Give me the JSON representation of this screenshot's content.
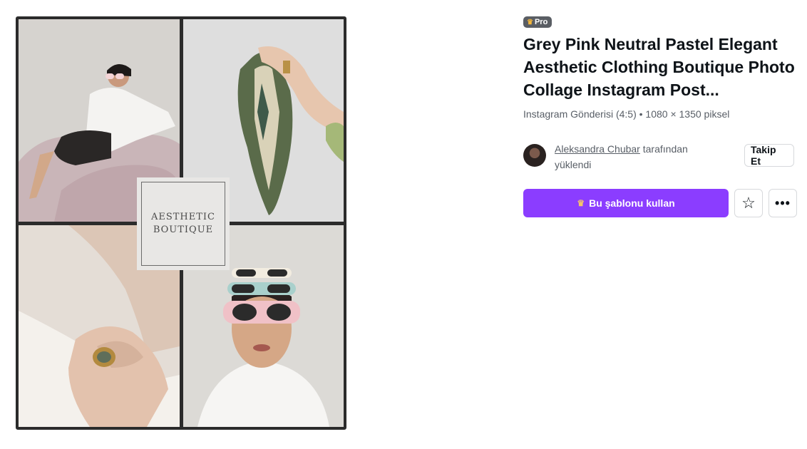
{
  "preview": {
    "logo_line1": "AESTHETIC",
    "logo_line2": "BOUTIQUE"
  },
  "badge": {
    "label": "Pro",
    "icon": "crown-icon"
  },
  "title": "Grey Pink Neutral Pastel Elegant Aesthetic Clothing Boutique Photo Collage Instagram Post...",
  "meta": "Instagram Gönderisi (4:5) • 1080 × 1350 piksel",
  "author": {
    "name": "Aleksandra Chubar",
    "suffix_line1": " tarafından",
    "suffix_line2": "yüklendi"
  },
  "follow_label": "Takip Et",
  "use_template_label": "Bu şablonu kullan",
  "icons": {
    "star": "☆",
    "more": "•••",
    "crown": "♛"
  },
  "colors": {
    "accent": "#8b3dff",
    "badge": "#5a5e64",
    "crown": "#f5b73b"
  }
}
